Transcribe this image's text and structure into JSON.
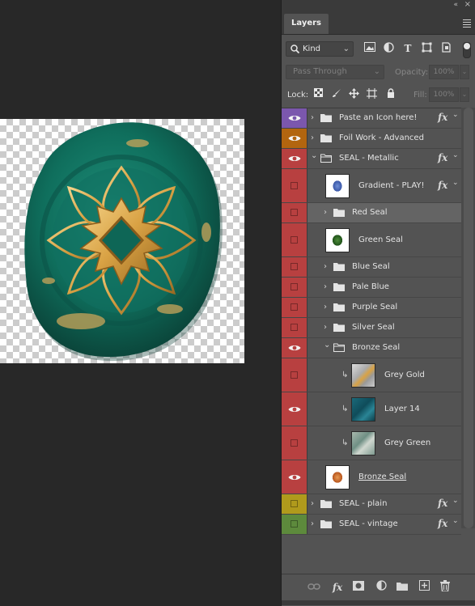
{
  "panel": {
    "tab_label": "Layers",
    "filter": {
      "kind_label": "Kind",
      "icons": [
        "image-filter-icon",
        "adjustment-filter-icon",
        "type-filter-icon",
        "shape-filter-icon",
        "smart-object-filter-icon"
      ]
    },
    "blend_mode": "Pass Through",
    "opacity_label": "Opacity:",
    "opacity_value": "100%",
    "lock_label": "Lock:",
    "fill_label": "Fill:",
    "fill_value": "100%"
  },
  "colors": {
    "purple": "#7b57ad",
    "orange": "#b2650f",
    "red": "#b84040",
    "yellow": "#b09a1c",
    "green": "#5d8a3c",
    "panel_bg": "#535353"
  },
  "layers": [
    {
      "name": "Paste an Icon here!",
      "type": "group",
      "color": "purple",
      "visible": true,
      "fx": true,
      "indent": 0,
      "expanded": false
    },
    {
      "name": "Foil Work - Advanced",
      "type": "group",
      "color": "orange",
      "visible": true,
      "fx": false,
      "indent": 0,
      "expanded": false
    },
    {
      "name": "SEAL - Metallic",
      "type": "group",
      "color": "red",
      "visible": true,
      "fx": true,
      "indent": 0,
      "expanded": true
    },
    {
      "name": "Gradient - PLAY!",
      "type": "layer",
      "color": "red",
      "visible": false,
      "fx": true,
      "indent": 1,
      "thumb": "blue-blob"
    },
    {
      "name": "Red Seal",
      "type": "group",
      "color": "red",
      "visible": false,
      "fx": false,
      "indent": 1,
      "expanded": false,
      "selected": true
    },
    {
      "name": "Green Seal",
      "type": "layer",
      "color": "red",
      "visible": false,
      "fx": false,
      "indent": 1,
      "thumb": "green-blob"
    },
    {
      "name": "Blue Seal",
      "type": "group",
      "color": "red",
      "visible": false,
      "fx": false,
      "indent": 1,
      "expanded": false
    },
    {
      "name": "Pale Blue",
      "type": "group",
      "color": "red",
      "visible": false,
      "fx": false,
      "indent": 1,
      "expanded": false
    },
    {
      "name": "Purple Seal",
      "type": "group",
      "color": "red",
      "visible": false,
      "fx": false,
      "indent": 1,
      "expanded": false
    },
    {
      "name": "Silver Seal",
      "type": "group",
      "color": "red",
      "visible": false,
      "fx": false,
      "indent": 1,
      "expanded": false
    },
    {
      "name": "Bronze Seal",
      "type": "group",
      "color": "red",
      "visible": true,
      "fx": false,
      "indent": 1,
      "expanded": true
    },
    {
      "name": "Grey Gold",
      "type": "layer",
      "color": "red",
      "visible": false,
      "fx": false,
      "indent": 2,
      "clipped": true,
      "thumb": "grey-gold"
    },
    {
      "name": "Layer 14",
      "type": "layer",
      "color": "red",
      "visible": true,
      "fx": false,
      "indent": 2,
      "clipped": true,
      "thumb": "teal"
    },
    {
      "name": "Grey Green",
      "type": "layer",
      "color": "red",
      "visible": false,
      "fx": false,
      "indent": 2,
      "clipped": true,
      "thumb": "grey-green"
    },
    {
      "name": "Bronze Seal",
      "type": "layer",
      "color": "red",
      "visible": true,
      "fx": false,
      "indent": 1,
      "thumb": "orange-blob",
      "underline": true
    },
    {
      "name": "SEAL - plain",
      "type": "group",
      "color": "yellow",
      "visible": false,
      "fx": true,
      "indent": 0,
      "expanded": false
    },
    {
      "name": "SEAL - vintage",
      "type": "group",
      "color": "green",
      "visible": false,
      "fx": true,
      "indent": 0,
      "expanded": false
    }
  ],
  "footer_icons": [
    "link-layers-icon",
    "add-style-icon",
    "add-mask-icon",
    "adjustment-layer-icon",
    "new-group-icon",
    "new-layer-icon",
    "delete-layer-icon"
  ]
}
